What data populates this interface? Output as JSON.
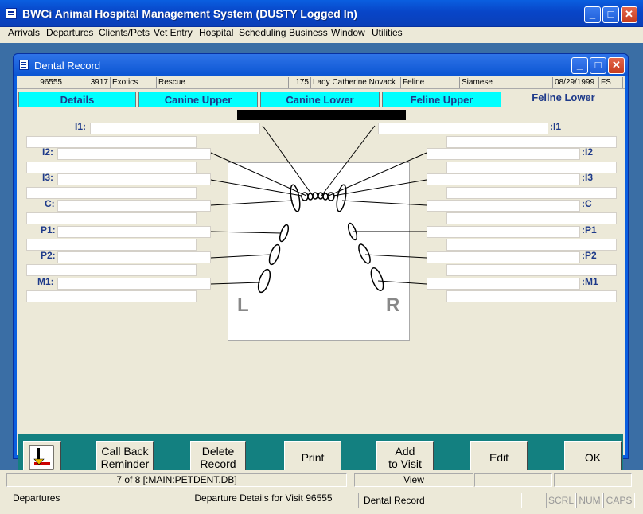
{
  "app": {
    "title": "BWCi Animal Hospital Management System (DUSTY Logged In)"
  },
  "menu": [
    "Arrivals",
    "Departures",
    "Clients/Pets",
    "Vet Entry",
    "Hospital",
    "Scheduling",
    "Business",
    "Window",
    "Utilities"
  ],
  "window": {
    "title": "Dental Record"
  },
  "info": {
    "id": "96555",
    "num": "3917",
    "type": "Exotics",
    "sub": "Rescue",
    "client_num": "175",
    "client_name": "Lady Catherine Novack",
    "species": "Feline",
    "breed": "Siamese",
    "date": "08/29/1999",
    "sex": "FS"
  },
  "tabs": [
    "Details",
    "Canine Upper",
    "Canine Lower",
    "Feline Upper",
    "Feline Lower"
  ],
  "labels_left": [
    "I1:",
    "I2:",
    "I3:",
    "C:",
    "P1:",
    "P2:",
    "M1:"
  ],
  "labels_right": [
    ":I1",
    ":I2",
    ":I3",
    ":C",
    ":P1",
    ":P2",
    ":M1"
  ],
  "diagram": {
    "left_label": "L",
    "right_label": "R"
  },
  "buttons": {
    "call_back_1": "Call Back",
    "call_back_2": "Reminder",
    "delete_1": "Delete",
    "delete_2": "Record",
    "print": "Print",
    "add_1": "Add",
    "add_2": "to Visit",
    "edit": "Edit",
    "ok": "OK"
  },
  "status": {
    "record": "7 of 8 [:MAIN:PETDENT.DB]",
    "mode": "View",
    "left": "Departures",
    "middle": "Departure Details for Visit 96555",
    "right": "Dental Record",
    "scrl": "SCRL",
    "num": "NUM",
    "caps": "CAPS"
  }
}
